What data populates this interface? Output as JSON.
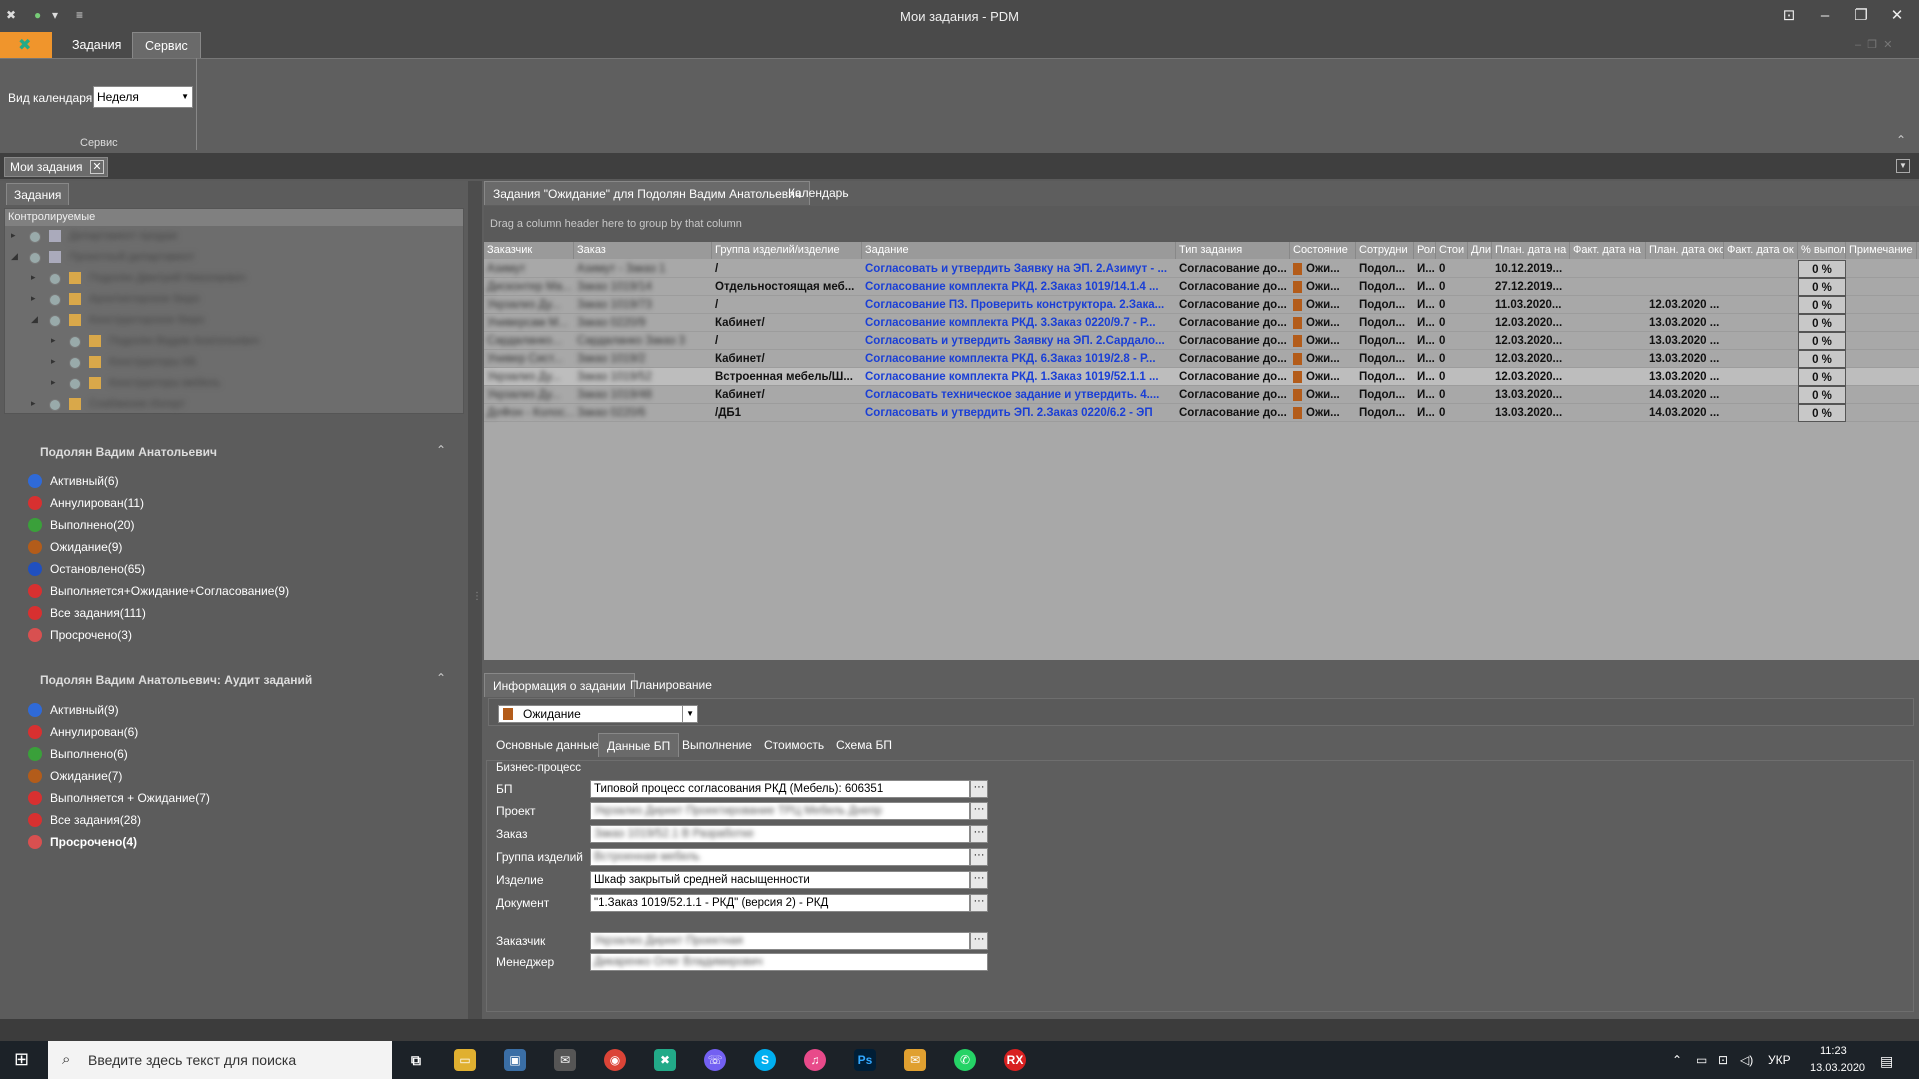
{
  "window": {
    "title": "Мои задания - PDM"
  },
  "ribbon": {
    "tabs": [
      "Задания",
      "Сервис"
    ],
    "calendar_label": "Вид календаря",
    "calendar_value": "Неделя",
    "group_label": "Сервис"
  },
  "doc_tab": {
    "label": "Мои задания",
    "close": "✕"
  },
  "left": {
    "tab": "Задания",
    "tree_header": "Контролируемые",
    "tree_items": [
      "Департамент продаж",
      "Проектный департамент",
      "Подолян Дмитрий Николаевич",
      "Архитекторское бюро",
      "Конструкторское бюро",
      "Подолян Вадим Анатольевич",
      "Конструкторы КБ",
      "Конструкторы мебель",
      "Снабжение Ингерт"
    ],
    "section1": {
      "title": "Подолян Вадим Анатольевич",
      "items": [
        {
          "label": "Активный(6)",
          "icon": "active-icon",
          "color": "#2f6ad8"
        },
        {
          "label": "Аннулирован(11)",
          "icon": "cancelled-icon",
          "color": "#d83030"
        },
        {
          "label": "Выполнено(20)",
          "icon": "done-icon",
          "color": "#3aa03a"
        },
        {
          "label": "Ожидание(9)",
          "icon": "hourglass-icon",
          "color": "#b35c1a"
        },
        {
          "label": "Остановлено(65)",
          "icon": "pause-icon",
          "color": "#2050c0"
        },
        {
          "label": "Выполняется+Ожидание+Согласование(9)",
          "icon": "running-icon",
          "color": "#d83030"
        },
        {
          "label": "Все задания(111)",
          "icon": "all-tasks-icon",
          "color": "#d83030"
        },
        {
          "label": "Просрочено(3)",
          "icon": "overdue-icon",
          "color": "#d85050"
        }
      ]
    },
    "section2": {
      "title": "Подолян Вадим Анатольевич: Аудит заданий",
      "items": [
        {
          "label": "Активный(9)",
          "icon": "active-icon",
          "color": "#2f6ad8"
        },
        {
          "label": "Аннулирован(6)",
          "icon": "cancelled-icon",
          "color": "#d83030"
        },
        {
          "label": "Выполнено(6)",
          "icon": "done-icon",
          "color": "#3aa03a"
        },
        {
          "label": "Ожидание(7)",
          "icon": "hourglass-icon",
          "color": "#b35c1a"
        },
        {
          "label": "Выполняется + Ожидание(7)",
          "icon": "running-icon",
          "color": "#d83030"
        },
        {
          "label": "Все задания(28)",
          "icon": "all-tasks-icon",
          "color": "#d83030"
        },
        {
          "label": "Просрочено(4)",
          "icon": "overdue-icon",
          "color": "#d85050"
        }
      ]
    }
  },
  "right": {
    "tabs": [
      "Задания \"Ожидание\" для Подолян Вадим Анатольевич",
      "Календарь"
    ],
    "group_hint": "Drag a column header here to group by that column",
    "columns": [
      "Заказчик",
      "Заказ",
      "Группа изделий/изделие",
      "Задание",
      "Тип задания",
      "Состояние",
      "Сотрудни",
      "Рол",
      "Стои",
      "Дли",
      "План. дата на",
      "Факт. дата на",
      "План. дата око",
      "Факт. дата ок",
      "% выпол",
      "Примечание"
    ],
    "rows": [
      {
        "customer": "Азимут",
        "order": "Азимут - Заказ 1",
        "group": "/",
        "task": "Согласовать и утвердить Заявку на ЭП. 2.Азимут - ...",
        "type": "Согласование до...",
        "state": "Ожи...",
        "emp": "Подол...",
        "role": "И...",
        "cost": "0",
        "plan_start": "10.12.2019...",
        "plan_end": "",
        "pct": "0 %"
      },
      {
        "customer": "Дисконтер Ма...",
        "order": "Заказ 1019/14",
        "group": "Отдельностоящая меб...",
        "task": "Согласование комплекта РКД. 2.Заказ 1019/14.1.4 ...",
        "type": "Согласование до...",
        "state": "Ожи...",
        "emp": "Подол...",
        "role": "И...",
        "cost": "0",
        "plan_start": "27.12.2019...",
        "plan_end": "",
        "pct": "0 %"
      },
      {
        "customer": "Укрзализ Ду...",
        "order": "Заказ 1019/73",
        "group": "/",
        "task": "Согласование ПЗ. Проверить конструктора. 2.Зака...",
        "type": "Согласование до...",
        "state": "Ожи...",
        "emp": "Подол...",
        "role": "И...",
        "cost": "0",
        "plan_start": "11.03.2020...",
        "plan_end": "12.03.2020 ...",
        "pct": "0 %"
      },
      {
        "customer": "Универсам М...",
        "order": "Заказ 0220/9",
        "group": "Кабинет/",
        "task": "Согласование комплекта РКД. 3.Заказ 0220/9.7 - Р...",
        "type": "Согласование до...",
        "state": "Ожи...",
        "emp": "Подол...",
        "role": "И...",
        "cost": "0",
        "plan_start": "12.03.2020...",
        "plan_end": "13.03.2020 ...",
        "pct": "0 %"
      },
      {
        "customer": "Сардаланко...",
        "order": "Сардаланко Заказ 3",
        "group": "/",
        "task": "Согласовать и утвердить Заявку на ЭП. 2.Сардало...",
        "type": "Согласование до...",
        "state": "Ожи...",
        "emp": "Подол...",
        "role": "И...",
        "cost": "0",
        "plan_start": "12.03.2020...",
        "plan_end": "13.03.2020 ...",
        "pct": "0 %"
      },
      {
        "customer": "Универ Сист...",
        "order": "Заказ 1019/2",
        "group": "Кабинет/",
        "task": "Согласование комплекта РКД. 6.Заказ 1019/2.8 - Р...",
        "type": "Согласование до...",
        "state": "Ожи...",
        "emp": "Подол...",
        "role": "И...",
        "cost": "0",
        "plan_start": "12.03.2020...",
        "plan_end": "13.03.2020 ...",
        "pct": "0 %"
      },
      {
        "customer": "Укрзализ Ду...",
        "order": "Заказ 1019/52",
        "group": "Встроенная мебель/Ш...",
        "task": "Согласование комплекта РКД. 1.Заказ 1019/52.1.1 ...",
        "type": "Согласование до...",
        "state": "Ожи...",
        "emp": "Подол...",
        "role": "И...",
        "cost": "0",
        "plan_start": "12.03.2020...",
        "plan_end": "13.03.2020 ...",
        "pct": "0 %"
      },
      {
        "customer": "Укрзализ Ду...",
        "order": "Заказ 1019/48",
        "group": "Кабинет/",
        "task": "Согласовать техническое задание и утвердить. 4....",
        "type": "Согласование до...",
        "state": "Ожи...",
        "emp": "Подол...",
        "role": "И...",
        "cost": "0",
        "plan_start": "13.03.2020...",
        "plan_end": "14.03.2020 ...",
        "pct": "0 %"
      },
      {
        "customer": "ДоФон - Колос...",
        "order": "Заказ 0220/6",
        "group": "/ДБ1",
        "task": "Согласовать и утвердить ЭП. 2.Заказ 0220/6.2 - ЭП",
        "type": "Согласование до...",
        "state": "Ожи...",
        "emp": "Подол...",
        "role": "И...",
        "cost": "0",
        "plan_start": "13.03.2020...",
        "plan_end": "14.03.2020 ...",
        "pct": "0 %"
      }
    ]
  },
  "bottom": {
    "tabs": [
      "Информация о задании",
      "Планирование"
    ],
    "status_value": "Ожидание",
    "subtabs": [
      "Основные данные",
      "Данные БП",
      "Выполнение",
      "Стоимость",
      "Схема БП"
    ],
    "group_title": "Бизнес-процесс",
    "fields": [
      {
        "label": "БП",
        "value": "Типовой процесс согласования РКД (Мебель): 606351"
      },
      {
        "label": "Проект",
        "value": "Укрзализ Директ Проектирование ТРЦ Мебель Днепр"
      },
      {
        "label": "Заказ",
        "value": "Заказ 1019/52.1 В Разработке"
      },
      {
        "label": "Группа изделий",
        "value": "Встроенная мебель"
      },
      {
        "label": "Изделие",
        "value": "Шкаф закрытый средней насыщенности"
      },
      {
        "label": "Документ",
        "value": "\"1.Заказ 1019/52.1.1 - РКД\" (версия 2) - РКД"
      },
      {
        "label": "Заказчик",
        "value": "Укрзализ Директ Проектная"
      },
      {
        "label": "Менеджер",
        "value": "Дикаренко Олег Владимирович"
      }
    ]
  },
  "taskbar": {
    "search_placeholder": "Введите здесь текст для поиска",
    "lang": "УКР",
    "time": "11:23",
    "date": "13.03.2020"
  }
}
